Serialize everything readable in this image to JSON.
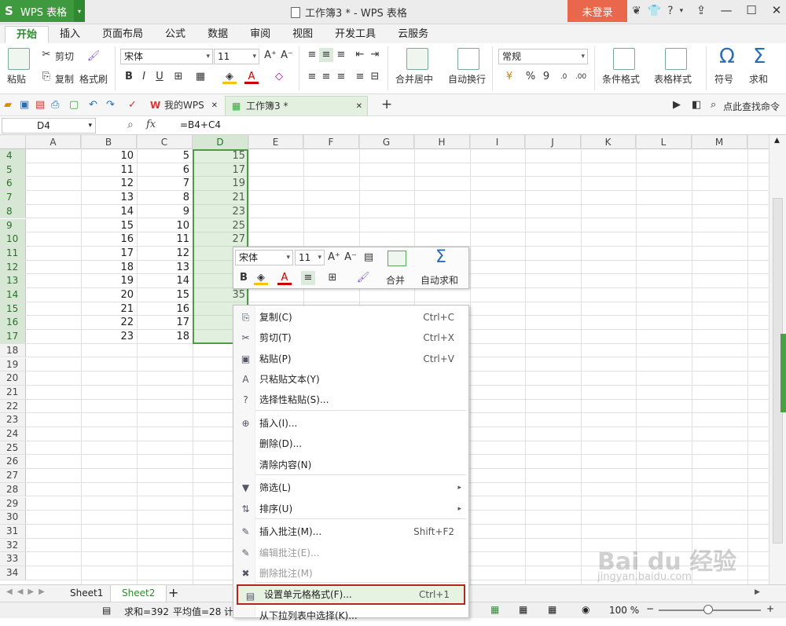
{
  "app": {
    "name": "WPS 表格",
    "title": "工作簿3 * - WPS 表格",
    "login": "未登录"
  },
  "tabs": [
    "开始",
    "插入",
    "页面布局",
    "公式",
    "数据",
    "审阅",
    "视图",
    "开发工具",
    "云服务"
  ],
  "ribbon": {
    "cut": "剪切",
    "paste": "粘贴",
    "copy": "复制",
    "format_painter": "格式刷",
    "font": "宋体",
    "size": "11",
    "merge": "合并居中",
    "wrap": "自动换行",
    "number_format": "常规",
    "percent": "%",
    "comma": "9",
    "cond_format": "条件格式",
    "table_style": "表格样式",
    "symbol": "符号",
    "sum": "求和"
  },
  "doc_tabs": [
    "我的WPS",
    "工作簿3 *"
  ],
  "find_command": "点此查找命令",
  "formula_bar": {
    "cell": "D4",
    "fx": "fx",
    "formula": "=B4+C4"
  },
  "columns": [
    "A",
    "B",
    "C",
    "D",
    "E",
    "F",
    "G",
    "H",
    "I",
    "J",
    "K",
    "L",
    "M"
  ],
  "rows": [
    {
      "n": "4",
      "b": "10",
      "c": "5",
      "d": "15"
    },
    {
      "n": "5",
      "b": "11",
      "c": "6",
      "d": "17"
    },
    {
      "n": "6",
      "b": "12",
      "c": "7",
      "d": "19"
    },
    {
      "n": "7",
      "b": "13",
      "c": "8",
      "d": "21"
    },
    {
      "n": "8",
      "b": "14",
      "c": "9",
      "d": "23"
    },
    {
      "n": "9",
      "b": "15",
      "c": "10",
      "d": "25"
    },
    {
      "n": "10",
      "b": "16",
      "c": "11",
      "d": "27"
    },
    {
      "n": "11",
      "b": "17",
      "c": "12",
      "d": ""
    },
    {
      "n": "12",
      "b": "18",
      "c": "13",
      "d": ""
    },
    {
      "n": "13",
      "b": "19",
      "c": "14",
      "d": ""
    },
    {
      "n": "14",
      "b": "20",
      "c": "15",
      "d": "35"
    },
    {
      "n": "15",
      "b": "21",
      "c": "16",
      "d": ""
    },
    {
      "n": "16",
      "b": "22",
      "c": "17",
      "d": ""
    },
    {
      "n": "17",
      "b": "23",
      "c": "18",
      "d": ""
    },
    {
      "n": "18",
      "b": "",
      "c": "",
      "d": ""
    },
    {
      "n": "19",
      "b": "",
      "c": "",
      "d": ""
    },
    {
      "n": "20",
      "b": "",
      "c": "",
      "d": ""
    },
    {
      "n": "21",
      "b": "",
      "c": "",
      "d": ""
    },
    {
      "n": "22",
      "b": "",
      "c": "",
      "d": ""
    },
    {
      "n": "23",
      "b": "",
      "c": "",
      "d": ""
    },
    {
      "n": "24",
      "b": "",
      "c": "",
      "d": ""
    },
    {
      "n": "25",
      "b": "",
      "c": "",
      "d": ""
    },
    {
      "n": "26",
      "b": "",
      "c": "",
      "d": ""
    },
    {
      "n": "27",
      "b": "",
      "c": "",
      "d": ""
    },
    {
      "n": "28",
      "b": "",
      "c": "",
      "d": ""
    },
    {
      "n": "29",
      "b": "",
      "c": "",
      "d": ""
    },
    {
      "n": "30",
      "b": "",
      "c": "",
      "d": ""
    },
    {
      "n": "31",
      "b": "",
      "c": "",
      "d": ""
    },
    {
      "n": "32",
      "b": "",
      "c": "",
      "d": ""
    },
    {
      "n": "33",
      "b": "",
      "c": "",
      "d": ""
    },
    {
      "n": "34",
      "b": "",
      "c": "",
      "d": ""
    }
  ],
  "mini_toolbar": {
    "font": "宋体",
    "size": "11",
    "merge": "合并",
    "autosum": "自动求和"
  },
  "context_menu": [
    {
      "icon": "copy-icon",
      "label": "复制(C)",
      "shortcut": "Ctrl+C",
      "disabled": false
    },
    {
      "icon": "cut-icon",
      "label": "剪切(T)",
      "shortcut": "Ctrl+X",
      "disabled": false
    },
    {
      "icon": "paste-icon",
      "label": "粘贴(P)",
      "shortcut": "Ctrl+V",
      "disabled": false
    },
    {
      "icon": "paste-text-icon",
      "label": "只粘贴文本(Y)",
      "shortcut": "",
      "disabled": false
    },
    {
      "icon": "paste-special-icon",
      "label": "选择性粘贴(S)...",
      "shortcut": "",
      "disabled": false
    },
    {
      "icon": "insert-icon",
      "label": "插入(I)...",
      "shortcut": "",
      "disabled": false
    },
    {
      "icon": "",
      "label": "删除(D)...",
      "shortcut": "",
      "disabled": false
    },
    {
      "icon": "",
      "label": "清除内容(N)",
      "shortcut": "",
      "disabled": false
    },
    {
      "icon": "filter-icon",
      "label": "筛选(L)",
      "shortcut": "",
      "disabled": false
    },
    {
      "icon": "sort-icon",
      "label": "排序(U)",
      "shortcut": "",
      "disabled": false
    },
    {
      "icon": "comment-insert-icon",
      "label": "插入批注(M)...",
      "shortcut": "Shift+F2",
      "disabled": false
    },
    {
      "icon": "comment-edit-icon",
      "label": "编辑批注(E)...",
      "shortcut": "",
      "disabled": true
    },
    {
      "icon": "comment-delete-icon",
      "label": "删除批注(M)",
      "shortcut": "",
      "disabled": true
    },
    {
      "icon": "format-cells-icon",
      "label": "设置单元格格式(F)...",
      "shortcut": "Ctrl+1",
      "disabled": false
    },
    {
      "icon": "",
      "label": "从下拉列表中选择(K)...",
      "shortcut": "",
      "disabled": false
    }
  ],
  "sheets": [
    "Sheet1",
    "Sheet2"
  ],
  "status": {
    "sum": "求和=392",
    "avg": "平均值=28",
    "count": "计",
    "zoom": "100 %"
  },
  "watermark": {
    "logo": "Bai du 经验",
    "url": "jingyan.baidu.com"
  },
  "colors": {
    "green": "#3f9a3f",
    "login": "#e9674a",
    "selection": "#4e9a45",
    "highlight_border": "#b3261e"
  }
}
